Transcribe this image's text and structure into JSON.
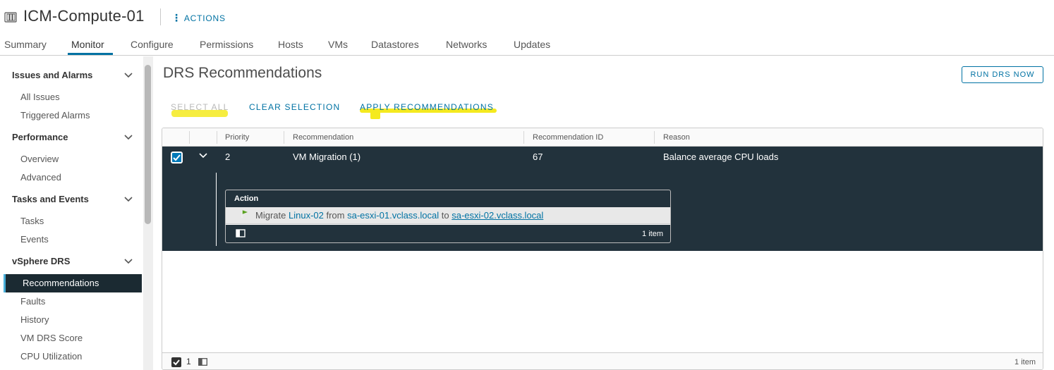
{
  "header": {
    "object_icon": "cluster-icon",
    "title": "ICM-Compute-01",
    "actions_label": "ACTIONS"
  },
  "tabs": [
    {
      "label": "Summary",
      "active": false
    },
    {
      "label": "Monitor",
      "active": true
    },
    {
      "label": "Configure",
      "active": false
    },
    {
      "label": "Permissions",
      "active": false
    },
    {
      "label": "Hosts",
      "active": false
    },
    {
      "label": "VMs",
      "active": false
    },
    {
      "label": "Datastores",
      "active": false
    },
    {
      "label": "Networks",
      "active": false
    },
    {
      "label": "Updates",
      "active": false
    }
  ],
  "sidebar": {
    "groups": [
      {
        "label": "Issues and Alarms",
        "items": [
          "All Issues",
          "Triggered Alarms"
        ]
      },
      {
        "label": "Performance",
        "items": [
          "Overview",
          "Advanced"
        ]
      },
      {
        "label": "Tasks and Events",
        "items": [
          "Tasks",
          "Events"
        ]
      },
      {
        "label": "vSphere DRS",
        "items": [
          "Recommendations",
          "Faults",
          "History",
          "VM DRS Score",
          "CPU Utilization"
        ]
      }
    ],
    "active_item": "Recommendations"
  },
  "main": {
    "title": "DRS Recommendations",
    "run_button": "RUN DRS NOW",
    "select_all": "SELECT ALL",
    "clear_selection": "CLEAR SELECTION",
    "apply_recommendations": "APPLY RECOMMENDATIONS"
  },
  "grid": {
    "columns": [
      "Priority",
      "Recommendation",
      "Recommendation ID",
      "Reason"
    ],
    "rows": [
      {
        "checked": true,
        "priority": "2",
        "recommendation": "VM Migration (1)",
        "id": "67",
        "reason": "Balance average CPU loads"
      }
    ],
    "detail": {
      "header": "Action",
      "row": {
        "verb": "Migrate",
        "vm": "Linux-02",
        "from_word": "from",
        "source": "sa-esxi-01.vclass.local",
        "to_word": "to",
        "target": "sa-esxi-02.vclass.local"
      },
      "count": "1 item"
    },
    "footer": {
      "selected_count": "1",
      "items": "1 item"
    }
  },
  "colors": {
    "accent": "#0072a3",
    "selected_row": "#22323c",
    "highlight": "#f5ea1f",
    "checkbox": "#0079b8"
  }
}
